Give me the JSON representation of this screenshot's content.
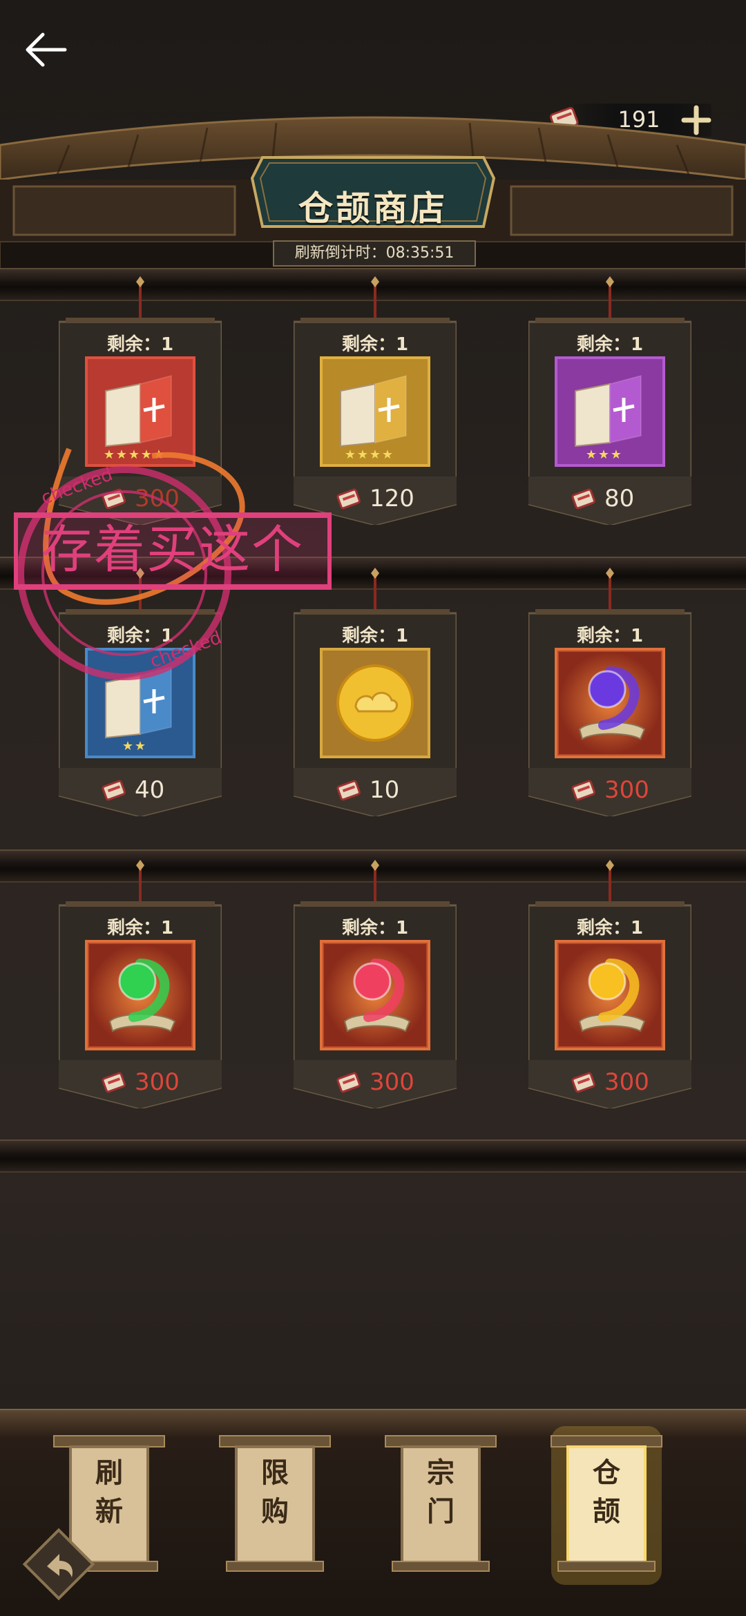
{
  "shop": {
    "title": "仓颉商店",
    "refresh_label": "刷新倒计时：08:35:51"
  },
  "currency": {
    "amount": "191"
  },
  "items": [
    {
      "remain": "剩余：1",
      "price": "300",
      "item": "book-red",
      "stars": 5,
      "price_color": "#b33a2a"
    },
    {
      "remain": "剩余：1",
      "price": "120",
      "item": "book-gold",
      "stars": 4,
      "price_color": "#f0e6d2"
    },
    {
      "remain": "剩余：1",
      "price": "80",
      "item": "book-purple",
      "stars": 3,
      "price_color": "#f0e6d2"
    },
    {
      "remain": "剩余：1",
      "price": "40",
      "item": "book-blue",
      "stars": 2,
      "price_color": "#f0e6d2"
    },
    {
      "remain": "剩余：1",
      "price": "10",
      "item": "gold-coin",
      "stars": 0,
      "price_color": "#f0e6d2"
    },
    {
      "remain": "剩余：1",
      "price": "300",
      "item": "scroll-purple",
      "stars": 0,
      "price_color": "#e0453a"
    },
    {
      "remain": "剩余：1",
      "price": "300",
      "item": "scroll-green",
      "stars": 0,
      "price_color": "#e0453a"
    },
    {
      "remain": "剩余：1",
      "price": "300",
      "item": "scroll-red",
      "stars": 0,
      "price_color": "#e0453a"
    },
    {
      "remain": "剩余：1",
      "price": "300",
      "item": "scroll-yellow",
      "stars": 0,
      "price_color": "#e0453a"
    }
  ],
  "stamp": {
    "text": "存着买这个",
    "ring_text": "checked"
  },
  "nav": {
    "tabs": [
      {
        "label": "刷\n新",
        "active": false
      },
      {
        "label": "限\n购",
        "active": false
      },
      {
        "label": "宗\n门",
        "active": false
      },
      {
        "label": "仓\n颉",
        "active": true
      }
    ]
  }
}
